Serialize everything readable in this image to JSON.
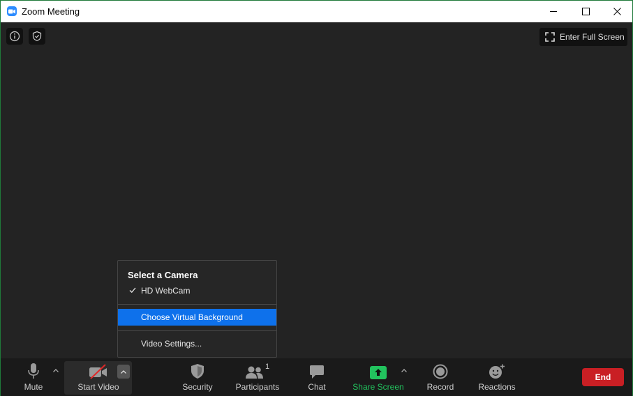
{
  "window": {
    "title": "Zoom Meeting",
    "icons": {
      "app": "zoom-camera-icon",
      "minimize": "minimize-icon",
      "maximize": "maximize-icon",
      "close": "close-icon"
    }
  },
  "meeting": {
    "top_icons": [
      "info-icon",
      "shield-icon"
    ],
    "full_screen_label": "Enter Full Screen"
  },
  "camera_menu": {
    "title": "Select a Camera",
    "cameras": [
      {
        "label": "HD WebCam",
        "selected": true
      }
    ],
    "virtual_background": "Choose Virtual Background",
    "video_settings": "Video Settings..."
  },
  "toolbar": {
    "mute": "Mute",
    "start_video": "Start Video",
    "security": "Security",
    "participants": "Participants",
    "participant_count": "1",
    "chat": "Chat",
    "share_screen": "Share Screen",
    "record": "Record",
    "reactions": "Reactions",
    "end": "End"
  },
  "colors": {
    "meeting_bg": "#232323",
    "toolbar_bg": "#1a1a1a",
    "accent_blue": "#0e71eb",
    "share_green": "#22c35e",
    "end_red": "#c91f24"
  }
}
